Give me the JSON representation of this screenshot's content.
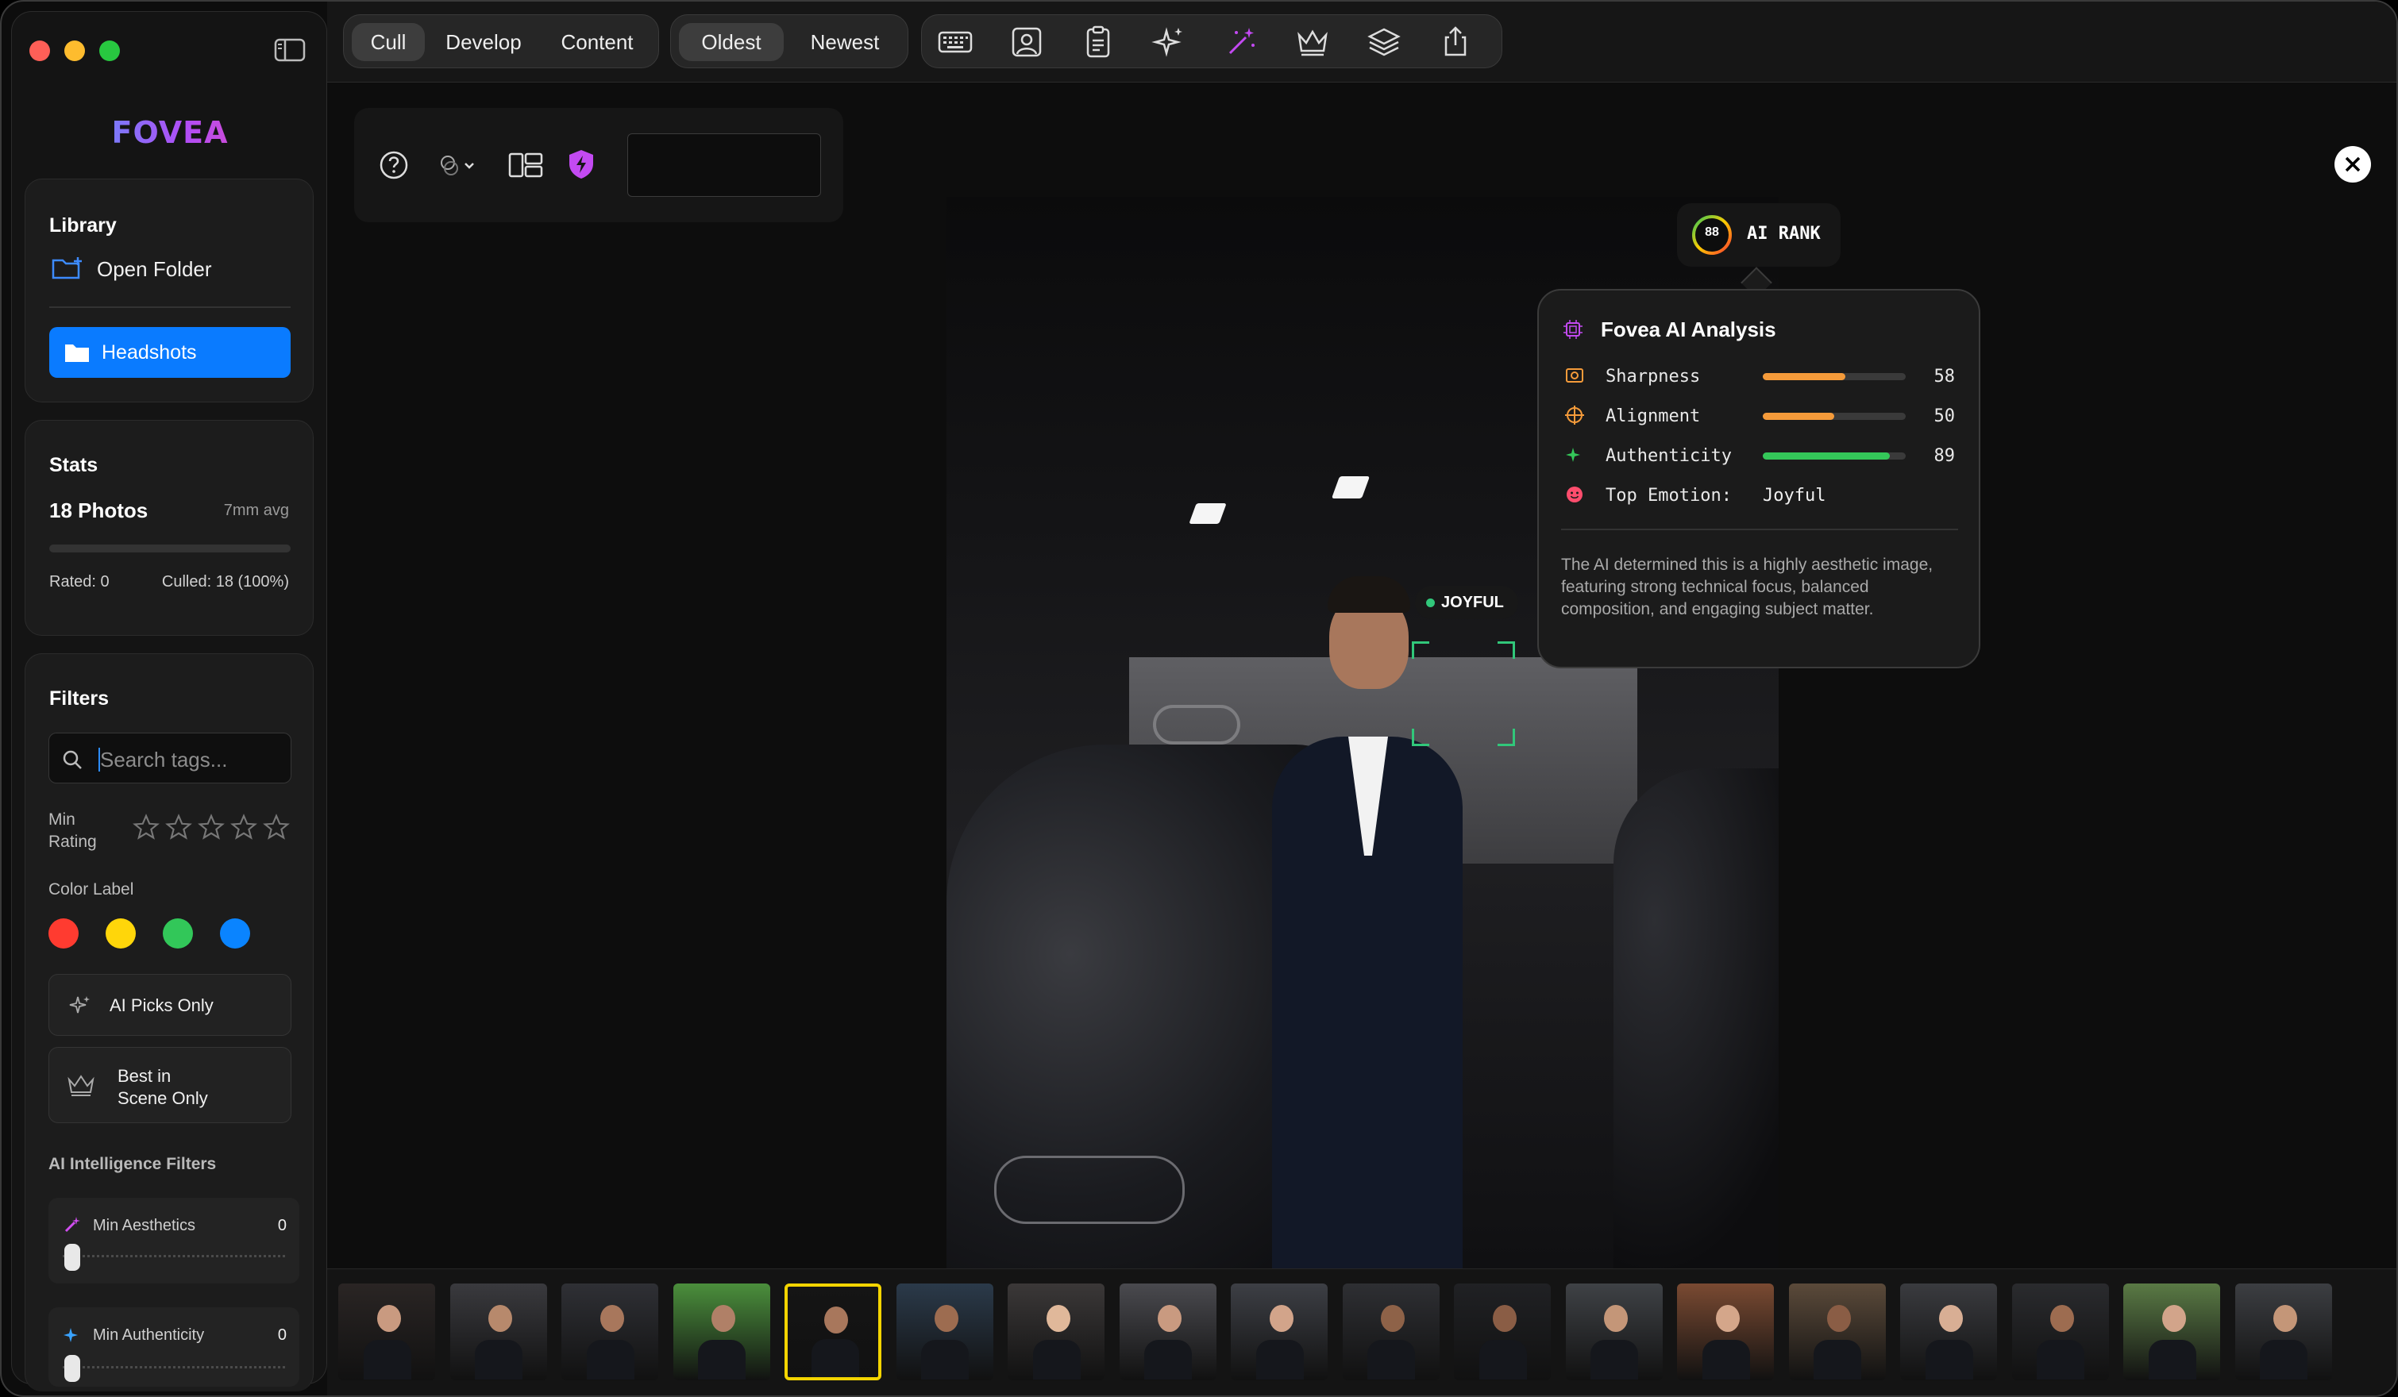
{
  "app": {
    "logo": "FOVEA"
  },
  "toolbar": {
    "modes": [
      "Cull",
      "Develop",
      "Content"
    ],
    "active_mode": "Cull",
    "sort": [
      "Oldest",
      "Newest"
    ],
    "active_sort": "Oldest",
    "icons": [
      "keyboard-icon",
      "portrait-icon",
      "clipboard-icon",
      "sparkles-icon",
      "magic-wand-icon",
      "crown-icon",
      "layers-icon",
      "share-icon"
    ]
  },
  "library": {
    "title": "Library",
    "open_folder": "Open Folder",
    "folder": "Headshots"
  },
  "stats": {
    "title": "Stats",
    "photos": "18 Photos",
    "avg": "7mm avg",
    "rated": "Rated: 0",
    "culled": "Culled: 18 (100%)",
    "progress": 0
  },
  "filters": {
    "title": "Filters",
    "search_placeholder": "Search tags...",
    "min_rating_label": "Min Rating",
    "min_rating_line1": "Min",
    "min_rating_line2": "Rating",
    "stars": 5,
    "color_label": "Color Label",
    "colors": [
      "#ff3b30",
      "#ffd60a",
      "#32c759",
      "#0a84ff"
    ],
    "ai_picks": "AI Picks Only",
    "best_scene_line1": "Best in",
    "best_scene_line2": "Scene Only",
    "ai_filters_title": "AI Intelligence Filters",
    "min_aesthetics_label": "Min Aesthetics",
    "min_aesthetics_value": "0",
    "min_authenticity_label": "Min Authenticity",
    "min_authenticity_value": "0"
  },
  "viewer": {
    "emotion_tag": "JOYFUL",
    "ai_rank_score": "88",
    "ai_rank_label": "AI RANK",
    "analysis": {
      "title": "Fovea AI Analysis",
      "metrics": [
        {
          "label": "Sharpness",
          "value": "58",
          "fraction": 0.58,
          "color": "#f59b3a"
        },
        {
          "label": "Alignment",
          "value": "50",
          "fraction": 0.5,
          "color": "#f59b3a"
        },
        {
          "label": "Authenticity",
          "value": "89",
          "fraction": 0.89,
          "color": "#34c759"
        }
      ],
      "emotion_label": "Top Emotion:",
      "emotion_value": "Joyful",
      "summary": "The AI determined this is a highly aesthetic image, featuring strong technical focus, balanced composition, and engaging subject matter."
    }
  },
  "filmstrip": {
    "count": 18,
    "selected_index": 4
  }
}
